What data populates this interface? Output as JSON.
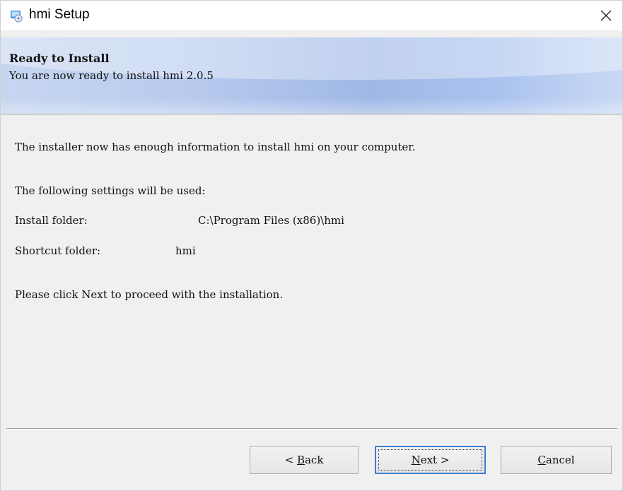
{
  "window": {
    "title": "hmi Setup"
  },
  "banner": {
    "title": "Ready to Install",
    "subtitle": "You are now ready to install hmi 2.0.5"
  },
  "body": {
    "intro": "The installer now has enough information to install hmi on your computer.",
    "settings_heading": "The following settings will be used:",
    "install_folder_label": "Install folder:",
    "install_folder_value": "C:\\Program Files (x86)\\hmi",
    "shortcut_folder_label": "Shortcut folder:",
    "shortcut_folder_value": "hmi",
    "instruction": "Please click Next to proceed with the installation."
  },
  "buttons": {
    "back_prefix": "< ",
    "back_mnemonic": "B",
    "back_rest": "ack",
    "next_mnemonic": "N",
    "next_rest": "ext >",
    "cancel_mnemonic": "C",
    "cancel_rest": "ancel"
  },
  "colors": {
    "focus_border": "#3c7fd1",
    "banner_gradient_mid": "#9fb8e6"
  }
}
